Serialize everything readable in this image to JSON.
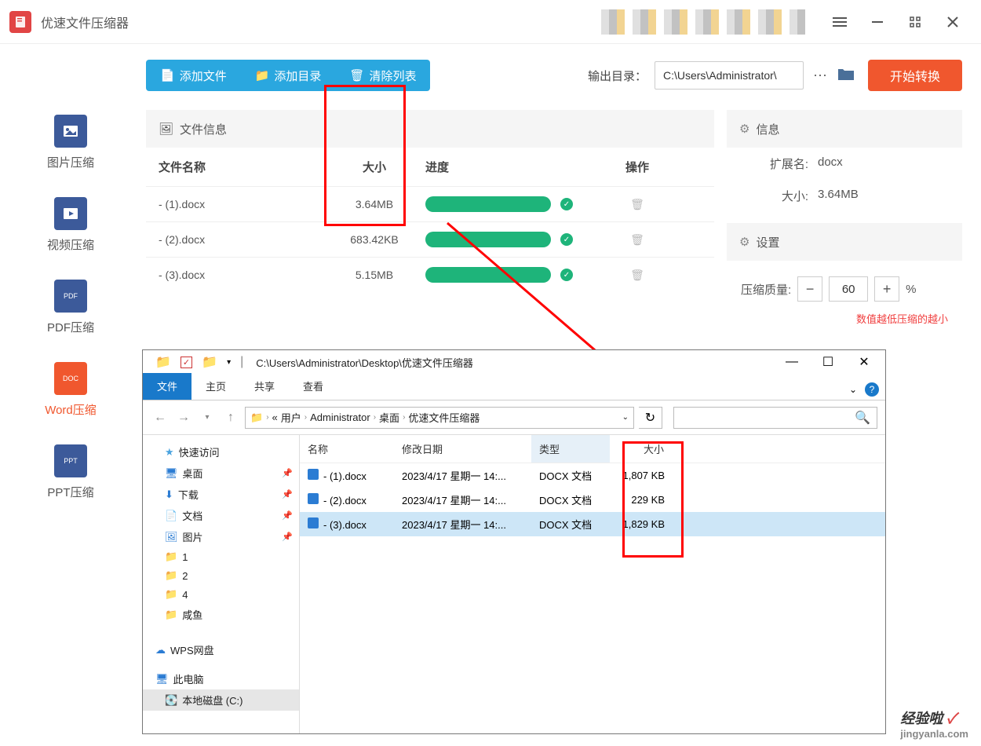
{
  "app": {
    "title": "优速文件压缩器"
  },
  "window_controls": {
    "menu": "≡",
    "min": "—",
    "max": "⛶",
    "close": "✕"
  },
  "sidebar": {
    "items": [
      {
        "icon": "IMG",
        "label": "图片压缩"
      },
      {
        "icon": "▶",
        "label": "视频压缩"
      },
      {
        "icon": "PDF",
        "label": "PDF压缩"
      },
      {
        "icon": "DOC",
        "label": "Word压缩"
      },
      {
        "icon": "PPT",
        "label": "PPT压缩"
      }
    ]
  },
  "toolbar": {
    "add_file": "添加文件",
    "add_dir": "添加目录",
    "clear_list": "清除列表",
    "output_label": "输出目录：",
    "output_path": "C:\\Users\\Administrator\\",
    "start": "开始转换"
  },
  "file_panel": {
    "title": "文件信息",
    "cols": {
      "name": "文件名称",
      "size": "大小",
      "progress": "进度",
      "op": "操作"
    },
    "rows": [
      {
        "name": "- (1).docx",
        "size": "3.64MB"
      },
      {
        "name": "- (2).docx",
        "size": "683.42KB"
      },
      {
        "name": "- (3).docx",
        "size": "5.15MB"
      }
    ]
  },
  "info_panel": {
    "title": "信息",
    "ext_label": "扩展名:",
    "ext_val": "docx",
    "size_label": "大小:",
    "size_val": "3.64MB"
  },
  "settings_panel": {
    "title": "设置",
    "quality_label": "压缩质量:",
    "quality_val": "60",
    "percent": "%",
    "hint": "数值越低压缩的越小"
  },
  "annotation": {
    "red_boxes": 3,
    "arrow": true
  },
  "explorer": {
    "path_text": "C:\\Users\\Administrator\\Desktop\\优速文件压缩器",
    "tabs": {
      "file": "文件",
      "home": "主页",
      "share": "共享",
      "view": "查看"
    },
    "crumbs": [
      "用户",
      "Administrator",
      "桌面",
      "优速文件压缩器"
    ],
    "crumb_prefix": "«",
    "tree": {
      "quick": "快速访问",
      "desktop": "桌面",
      "downloads": "下载",
      "documents": "文档",
      "pictures": "图片",
      "f1": "1",
      "f2": "2",
      "f4": "4",
      "xy": "咸鱼",
      "wps": "WPS网盘",
      "pc": "此电脑",
      "cdrive": "本地磁盘 (C:)"
    },
    "cols": {
      "name": "名称",
      "date": "修改日期",
      "type": "类型",
      "size": "大小"
    },
    "files": [
      {
        "name": "- (1).docx",
        "date": "2023/4/17 星期一 14:...",
        "type": "DOCX 文档",
        "size": "1,807 KB"
      },
      {
        "name": "- (2).docx",
        "date": "2023/4/17 星期一 14:...",
        "type": "DOCX 文档",
        "size": "229 KB"
      },
      {
        "name": "- (3).docx",
        "date": "2023/4/17 星期一 14:...",
        "type": "DOCX 文档",
        "size": "1,829 KB"
      }
    ]
  },
  "watermark": {
    "cn": "经验啦",
    "check": "✓",
    "domain": "jingyanla.com"
  }
}
